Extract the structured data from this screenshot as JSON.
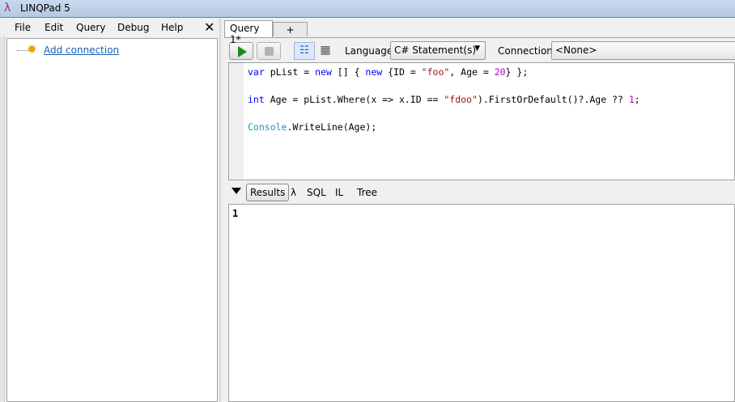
{
  "window": {
    "title": "LINQPad 5",
    "logo": "λ"
  },
  "menu": {
    "items": [
      "File",
      "Edit",
      "Query",
      "Debug",
      "Help"
    ],
    "close": "✕"
  },
  "tree": {
    "add_connection": "Add connection",
    "icon": "sun-icon"
  },
  "tabs": [
    {
      "label": "Query 1*"
    },
    {
      "label": "+"
    }
  ],
  "toolbar": {
    "language_label": "Language",
    "language_value": "C# Statement(s)",
    "connection_label": "Connection",
    "connection_value": "<None>"
  },
  "code": {
    "lines": [
      [
        {
          "t": "var",
          "c": "kw"
        },
        {
          "t": " pList = ",
          "c": "plain"
        },
        {
          "t": "new",
          "c": "kw"
        },
        {
          "t": " [] { ",
          "c": "plain"
        },
        {
          "t": "new",
          "c": "kw"
        },
        {
          "t": " {ID = ",
          "c": "plain"
        },
        {
          "t": "\"foo\"",
          "c": "str"
        },
        {
          "t": ", Age = ",
          "c": "plain"
        },
        {
          "t": "20",
          "c": "num"
        },
        {
          "t": "} };",
          "c": "plain"
        }
      ],
      [],
      [
        {
          "t": "int",
          "c": "kw"
        },
        {
          "t": " Age = pList.Where(x => x.ID == ",
          "c": "plain"
        },
        {
          "t": "\"fdoo\"",
          "c": "str"
        },
        {
          "t": ").FirstOrDefault()?.Age ?? ",
          "c": "plain"
        },
        {
          "t": "1",
          "c": "num"
        },
        {
          "t": ";",
          "c": "plain"
        }
      ],
      [],
      [
        {
          "t": "Console",
          "c": "type"
        },
        {
          "t": ".WriteLine(Age);",
          "c": "plain"
        }
      ]
    ],
    "colors": {
      "keyword": "#0000ff",
      "string": "#a31515",
      "number": "#c000c0",
      "type": "#2b91af"
    }
  },
  "results": {
    "tabs": [
      "Results",
      "λ",
      "SQL",
      "IL",
      "Tree"
    ],
    "output": "1"
  }
}
